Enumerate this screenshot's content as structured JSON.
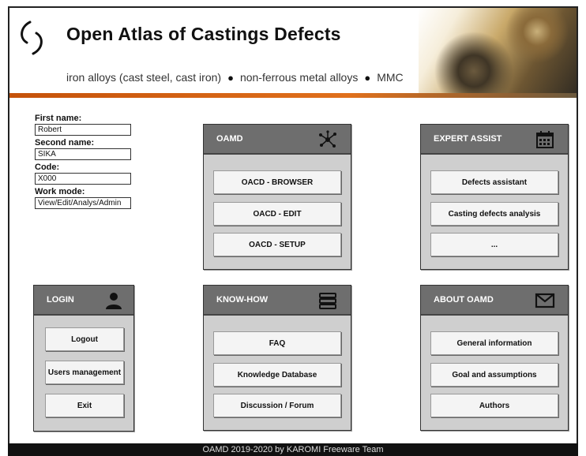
{
  "header": {
    "title": "Open Atlas of Castings Defects",
    "subtitle_items": [
      "iron alloys (cast steel, cast iron)",
      "non-ferrous metal alloys",
      "MMC"
    ],
    "separator": "●"
  },
  "user_form": {
    "first_name_label": "First name:",
    "first_name_value": "Robert",
    "second_name_label": "Second name:",
    "second_name_value": "SIKA",
    "code_label": "Code:",
    "code_value": "X000",
    "work_mode_label": "Work mode:",
    "work_mode_value": "View/Edit/Analys/Admin"
  },
  "panels": {
    "oamd": {
      "title": "OAMD",
      "icon": "network-icon",
      "buttons": [
        "OACD - BROWSER",
        "OACD - EDIT",
        "OACD - SETUP"
      ]
    },
    "expert_assist": {
      "title": "EXPERT ASSIST",
      "icon": "calendar-icon",
      "buttons": [
        "Defects assistant",
        "Casting defects analysis",
        "..."
      ]
    },
    "login": {
      "title": "LOGIN",
      "icon": "user-icon",
      "buttons": [
        "Logout",
        "Users management",
        "Exit"
      ]
    },
    "know_how": {
      "title": "KNOW-HOW",
      "icon": "stack-icon",
      "buttons": [
        "FAQ",
        "Knowledge Database",
        "Discussion / Forum"
      ]
    },
    "about": {
      "title": "ABOUT OAMD",
      "icon": "envelope-icon",
      "buttons": [
        "General information",
        "Goal and assumptions",
        "Authors"
      ]
    }
  },
  "footer": {
    "text": "OAMD 2019-2020 by KAROMI Freeware Team"
  },
  "colors": {
    "panel_header": "#6e6e6e",
    "panel_body": "#cfcfcf",
    "accent_bar": "#e0701c"
  }
}
